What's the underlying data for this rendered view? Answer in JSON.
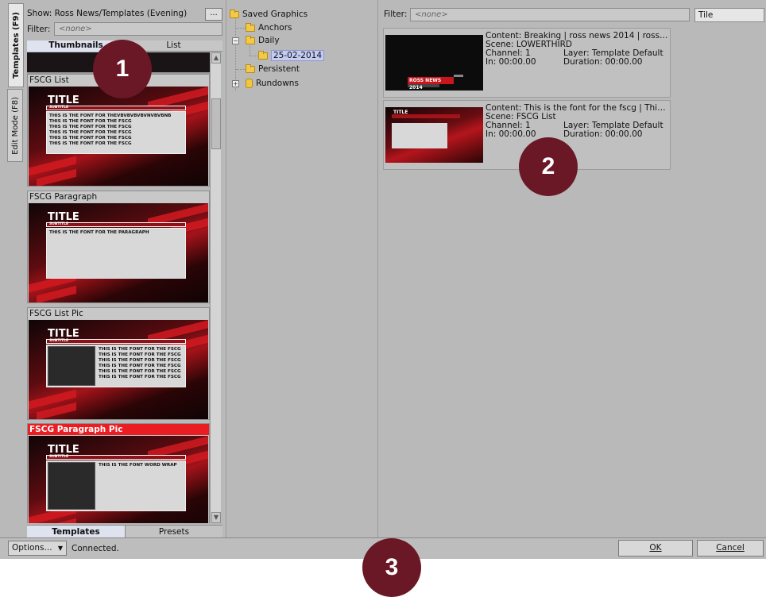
{
  "vertical_tabs": [
    {
      "label": "Templates (F9)"
    },
    {
      "label": "Edit Mode (F8)"
    }
  ],
  "left_panel": {
    "show_label": "Show:",
    "show_value": "Ross News/Templates (Evening)",
    "browse_button": "...",
    "filter_label": "Filter:",
    "filter_placeholder": "<none>",
    "view_tabs": [
      "Thumbnails",
      "List"
    ],
    "templates": [
      {
        "name": "FSCG List",
        "thumb_title": "TITLE",
        "thumb_subtitle": "SUBTITLE",
        "lines": [
          "THIS IS THE FONT FOR THEVBVBVBVBVNVBVBNB",
          "THIS IS THE FONT FOR THE FSCG",
          "THIS IS THE FONT FOR THE FSCG",
          "THIS IS THE FONT FOR THE FSCG",
          "THIS IS THE FONT FOR THE FSCG",
          "THIS IS THE FONT FOR THE FSCG"
        ]
      },
      {
        "name": "FSCG Paragraph",
        "thumb_title": "TITLE",
        "thumb_subtitle": "SUBTITLE",
        "lines": [
          "THIS IS THE FONT FOR THE PARAGRAPH"
        ]
      },
      {
        "name": "FSCG List Pic",
        "thumb_title": "TITLE",
        "thumb_subtitle": "SUBTITLE",
        "lines": [
          "THIS IS THE FONT FOR THE FSCG",
          "THIS IS THE FONT FOR THE FSCG",
          "THIS IS THE FONT FOR THE FSCG",
          "THIS IS THE FONT FOR THE FSCG",
          "THIS IS THE FONT FOR THE FSCG",
          "THIS IS THE FONT FOR THE FSCG"
        ]
      },
      {
        "name": "FSCG Paragraph Pic",
        "thumb_title": "TITLE",
        "thumb_subtitle": "SUBTITLE",
        "lines": [
          "THIS IS THE FONT WORD WRAP"
        ]
      }
    ],
    "bottom_tabs": [
      "Templates",
      "Presets"
    ]
  },
  "tree": {
    "root": "Saved Graphics",
    "anchors": "Anchors",
    "daily": "Daily",
    "date": "25-02-2014",
    "persistent": "Persistent",
    "rundowns": "Rundowns",
    "expand_symbol": "+",
    "collapse_symbol": "−"
  },
  "right_panel": {
    "filter_label": "Filter:",
    "filter_placeholder": "<none>",
    "view_mode": "Tile",
    "items": [
      {
        "content": "Content: Breaking | ross news 2014 | ross New…",
        "scene": "Scene: LOWERTHIRD",
        "channel": "Channel: 1",
        "layer": "Layer: Template Default",
        "in": "In: 00:00.00",
        "duration": "Duration: 00:00.00",
        "thumb_text": "ROSS NEWS 2014"
      },
      {
        "content": "Content: This is the font for the fscg | This is t…",
        "scene": "Scene: FSCG List",
        "channel": "Channel: 1",
        "layer": "Layer: Template Default",
        "in": "In: 00:00.00",
        "duration": "Duration: 00:00.00",
        "thumb_text": "TITLE"
      }
    ]
  },
  "status_bar": {
    "options_label": "Options...",
    "dropdown_arrow": "▼",
    "status": "Connected.",
    "ok_label": "OK",
    "cancel_label": "Cancel"
  },
  "scroll_arrows": {
    "up": "▲",
    "down": "▼"
  },
  "callouts": [
    "1",
    "2",
    "3"
  ],
  "colors": {
    "accent_red": "#ea1d23",
    "callout": "#6a1726",
    "selection": "#c4ccf2"
  }
}
